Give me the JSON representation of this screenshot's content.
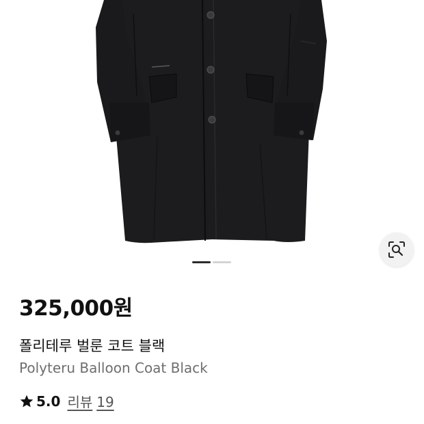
{
  "product": {
    "price": "325,000원",
    "title_ko": "폴리테루 벌룬 코트 블랙",
    "title_en": "Polyteru Balloon Coat Black",
    "rating": "5.0",
    "review_label": "리뷰",
    "review_count": "19"
  },
  "gallery": {
    "image_name": "black-coat-photo",
    "page_count": 2,
    "active_page": 1,
    "lens_icon": "visual-search-icon"
  },
  "colors": {
    "coat": "#1c1c1e",
    "accent_text": "#111111",
    "muted_text": "#6e6e6e",
    "pager_active": "#2b2b2b",
    "pager_inactive": "#d4d4d4",
    "star": "#111111"
  }
}
